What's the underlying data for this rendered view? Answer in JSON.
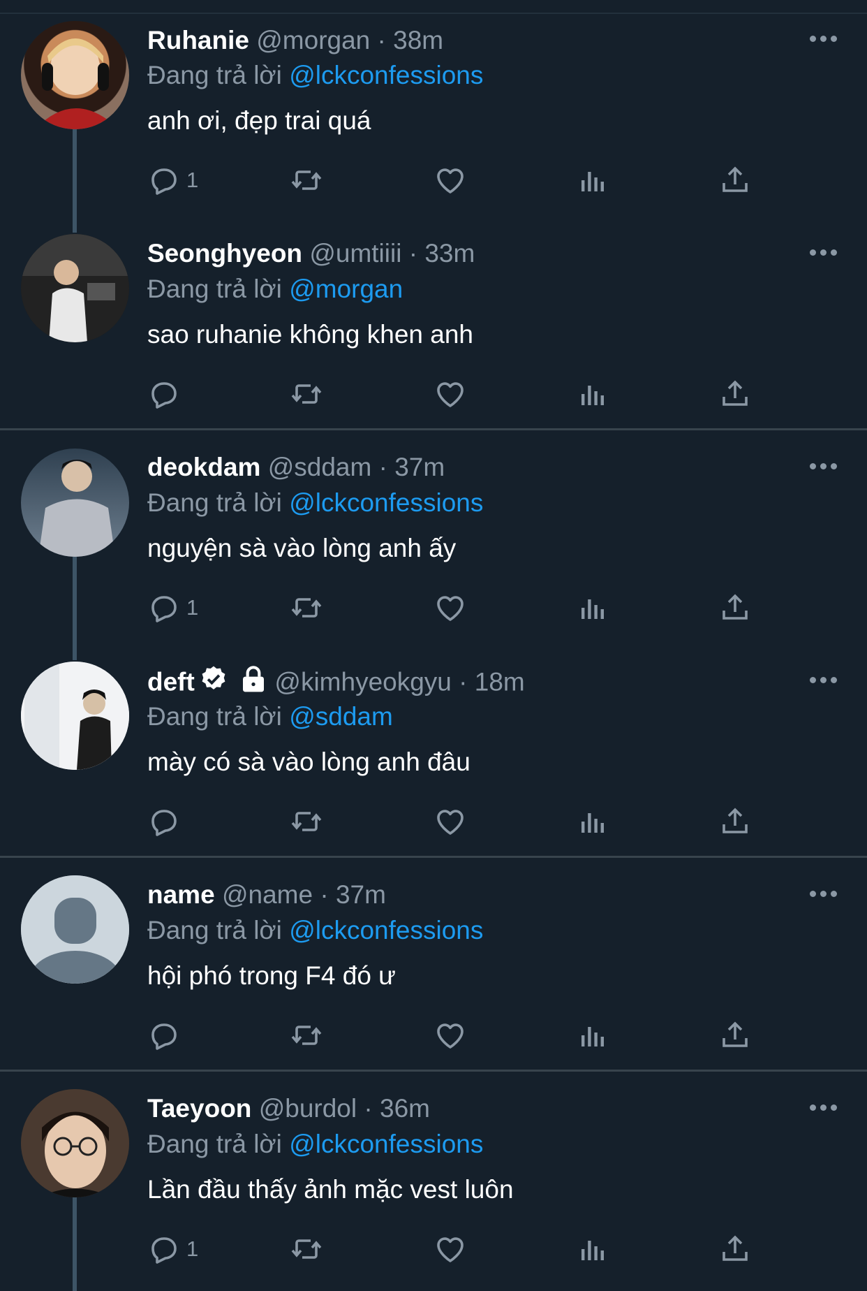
{
  "reply_prefix": "Đang trả lời",
  "tweets": [
    {
      "name": "Ruhanie",
      "handle": "@morgan",
      "sep": "·",
      "time": "38m",
      "reply_to": "@lckconfessions",
      "text": "anh ơi, đẹp trai quá",
      "reply_count": "1"
    },
    {
      "name": "Seonghyeon",
      "handle": "@umtiiii",
      "sep": "·",
      "time": "33m",
      "reply_to": "@morgan",
      "text": "sao ruhanie không khen anh",
      "reply_count": ""
    },
    {
      "name": "deokdam",
      "handle": "@sddam",
      "sep": "·",
      "time": "37m",
      "reply_to": "@lckconfessions",
      "text": "nguyện sà vào lòng anh ấy",
      "reply_count": "1"
    },
    {
      "name": "deft",
      "handle": "@kimhyeokgyu",
      "sep": "·",
      "time": "18m",
      "reply_to": "@sddam",
      "text": "mày có sà vào lòng anh đâu",
      "reply_count": "",
      "verified": true,
      "locked": true
    },
    {
      "name": "name",
      "handle": "@name",
      "sep": "·",
      "time": "37m",
      "reply_to": "@lckconfessions",
      "text": "hội phó trong F4 đó ư",
      "reply_count": ""
    },
    {
      "name": "Taeyoon",
      "handle": "@burdol",
      "sep": "·",
      "time": "36m",
      "reply_to": "@lckconfessions",
      "text": "Lần đầu thấy ảnh mặc vest luôn",
      "reply_count": "1"
    }
  ],
  "colors": {
    "background": "#15202b",
    "secondary_text": "#8b98a5",
    "link": "#1d9bf0",
    "divider": "#38444d"
  },
  "icons": [
    "reply-icon",
    "retweet-icon",
    "like-icon",
    "views-icon",
    "share-icon",
    "more-icon",
    "verified-icon",
    "lock-icon"
  ]
}
